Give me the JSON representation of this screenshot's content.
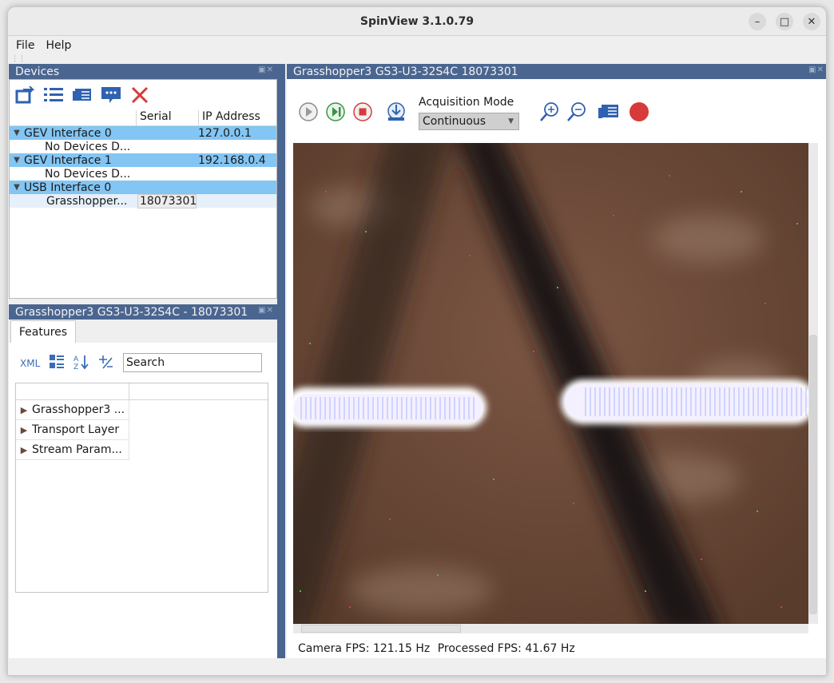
{
  "window": {
    "title": "SpinView 3.1.0.79"
  },
  "menu": {
    "file": "File",
    "help": "Help"
  },
  "devices": {
    "title": "Devices",
    "columns": {
      "serial": "Serial",
      "ip": "IP Address"
    },
    "rows": [
      {
        "name": "GEV Interface 0",
        "serial": "",
        "ip": "127.0.0.1",
        "selected": true
      },
      {
        "name": "No Devices D...",
        "serial": "",
        "ip": "",
        "selected": false
      },
      {
        "name": "GEV Interface 1",
        "serial": "",
        "ip": "192.168.0.4",
        "selected": true
      },
      {
        "name": "No Devices D...",
        "serial": "",
        "ip": "",
        "selected": false
      },
      {
        "name": "USB Interface 0",
        "serial": "",
        "ip": "",
        "selected": true
      },
      {
        "name": "Grasshopper...",
        "serial": "18073301",
        "ip": "",
        "selected": false
      }
    ]
  },
  "features": {
    "title": "Grasshopper3 GS3-U3-32S4C - 18073301",
    "tab": "Features",
    "xml_label": "XML",
    "search_placeholder": "Search",
    "items": [
      "Grasshopper3 ...",
      "Transport Layer",
      "Stream Param..."
    ]
  },
  "camera": {
    "title": "Grasshopper3 GS3-U3-32S4C 18073301",
    "acq_label": "Acquisition Mode",
    "acq_value": "Continuous",
    "camera_fps": "Camera FPS: 121.15 Hz",
    "processed_fps": "Processed FPS: 41.67 Hz"
  },
  "colors": {
    "panel_header": "#4a6690",
    "selected_row": "#83c5f3",
    "record": "#d83a3a"
  }
}
